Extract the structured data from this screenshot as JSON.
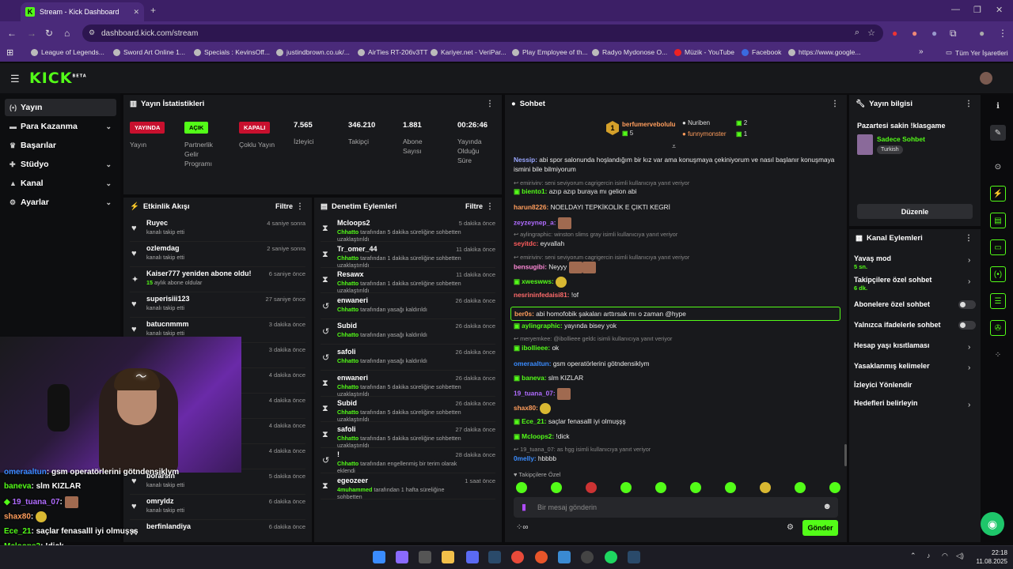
{
  "browser": {
    "tab_title": "Stream - Kick Dashboard",
    "url": "dashboard.kick.com/stream",
    "bookmarks": [
      "League of Legends...",
      "Sword Art Online 1...",
      "Specials : KevinsOff...",
      "justindbrown.co.uk/...",
      "AirTies RT-206v3TT",
      "Kariyer.net - VeriPar...",
      "Play Employee of th...",
      "Radyo Mydonose O...",
      "Müzik - YouTube",
      "Facebook",
      "https://www.google..."
    ],
    "all_bookmarks": "Tüm Yer İşaretleri"
  },
  "app": {
    "logo": "KICK",
    "logo_sup": "BETA"
  },
  "sidebar": {
    "items": [
      {
        "label": "Yayın",
        "icon": "broadcast-icon"
      },
      {
        "label": "Para Kazanma",
        "icon": "money-icon"
      },
      {
        "label": "Başarılar",
        "icon": "trophy-icon"
      },
      {
        "label": "Stüdyo",
        "icon": "studio-icon"
      },
      {
        "label": "Kanal",
        "icon": "channel-icon"
      },
      {
        "label": "Ayarlar",
        "icon": "gear-icon"
      }
    ]
  },
  "stats": {
    "title": "Yayın İstatistikleri",
    "badges": [
      {
        "badge": "YAYINDA",
        "label": "Yayın",
        "color": "#c8102e"
      },
      {
        "badge": "AÇIK",
        "label": "Partnerlik Gelir Programı",
        "color": "#53fc18"
      },
      {
        "badge": "KAPALI",
        "label": "Çoklu Yayın",
        "color": "#c8102e"
      }
    ],
    "values": [
      {
        "value": "7.565",
        "label": "İzleyici"
      },
      {
        "value": "346.210",
        "label": "Takipçi"
      },
      {
        "value": "1.881",
        "label": "Abone Sayısı"
      },
      {
        "value": "00:26:46",
        "label": "Yayında Olduğu Süre"
      }
    ]
  },
  "activity": {
    "title": "Etkinlik Akışı",
    "filter": "Filtre",
    "items": [
      {
        "name": "Ruyec",
        "desc": "kanalı takip etti",
        "time": "4 saniye sonra"
      },
      {
        "name": "ozlemdag",
        "desc": "kanalı takip etti",
        "time": "2 saniye sonra"
      },
      {
        "name": "Kaiser777 yeniden abone oldu!",
        "desc_num": "15",
        "desc": "aylık abone oldular",
        "time": "6 saniye önce"
      },
      {
        "name": "superisiii123",
        "desc": "kanalı takip etti",
        "time": "27 saniye önce"
      },
      {
        "name": "batucnmmm",
        "desc": "kanalı takip etti",
        "time": "3 dakika önce"
      },
      {
        "name": "",
        "desc": "",
        "time": "3 dakika önce"
      },
      {
        "name": "",
        "desc": "",
        "time": "4 dakika önce"
      },
      {
        "name": "",
        "desc": "",
        "time": "4 dakika önce"
      },
      {
        "name": "",
        "desc": "",
        "time": "4 dakika önce"
      },
      {
        "name": "",
        "desc": "",
        "time": "4 dakika önce"
      },
      {
        "name": "borarsln",
        "desc": "kanalı takip etti",
        "time": "5 dakika önce"
      },
      {
        "name": "omryldz",
        "desc": "kanalı takip etti",
        "time": "6 dakika önce"
      },
      {
        "name": "berfinlandiya",
        "desc": "",
        "time": "6 dakika önce"
      }
    ]
  },
  "moderation": {
    "title": "Denetim Eylemleri",
    "filter": "Filtre",
    "items": [
      {
        "name": "Mcloops2",
        "by": "Chhatto",
        "desc": "tarafından 5 dakika süreliğine sohbetten uzaklaştırıldı",
        "time": "5 dakika önce",
        "icon": "timer-icon"
      },
      {
        "name": "Tr_omer_44",
        "by": "Chhatto",
        "desc": "tarafından 1 dakika süreliğine sohbetten uzaklaştırıldı",
        "time": "11 dakika önce",
        "icon": "timer-icon"
      },
      {
        "name": "Resawx",
        "by": "Chhatto",
        "desc": "tarafından 1 dakika süreliğine sohbetten uzaklaştırıldı",
        "time": "11 dakika önce",
        "icon": "timer-icon"
      },
      {
        "name": "enwaneri",
        "by": "Chhatto",
        "desc": "tarafından yasağı kaldırıldı",
        "time": "26 dakika önce",
        "icon": "undo-icon"
      },
      {
        "name": "Subid",
        "by": "Chhatto",
        "desc": "tarafından yasağı kaldırıldı",
        "time": "26 dakika önce",
        "icon": "undo-icon"
      },
      {
        "name": "safoli",
        "by": "Chhatto",
        "desc": "tarafından yasağı kaldırıldı",
        "time": "26 dakika önce",
        "icon": "undo-icon"
      },
      {
        "name": "enwaneri",
        "by": "Chhatto",
        "desc": "tarafından 5 dakika süreliğine sohbetten uzaklaştırıldı",
        "time": "26 dakika önce",
        "icon": "timer-icon"
      },
      {
        "name": "Subid",
        "by": "Chhatto",
        "desc": "tarafından 5 dakika süreliğine sohbetten uzaklaştırıldı",
        "time": "26 dakika önce",
        "icon": "timer-icon"
      },
      {
        "name": "safoli",
        "by": "Chhatto",
        "desc": "tarafından 5 dakika süreliğine sohbetten uzaklaştırıldı",
        "time": "27 dakika önce",
        "icon": "timer-icon"
      },
      {
        "name": "!",
        "by": "Chhatto",
        "desc": "tarafından engellenmiş bir terim olarak eklendi",
        "time": "28 dakika önce",
        "icon": "undo-icon"
      },
      {
        "name": "egeozeer",
        "by": "4muhammed",
        "desc": "tarafından 1 hafta süreliğine sohbetten",
        "time": "1 saat önce",
        "icon": "timer-icon"
      }
    ]
  },
  "chat": {
    "title": "Sohbet",
    "top_gifters": [
      {
        "name": "berfumerveboluIu",
        "count": "5"
      },
      {
        "name": "Nuriben",
        "count": "2"
      },
      {
        "name": "funnymonster",
        "count": "1"
      }
    ],
    "messages": [
      {
        "user": "Nessip",
        "color": "#9aa7ff",
        "text": "abi spor salonunda hoşlandığım bir kız var ama konuşmaya çekiniyorum ve nasıl başlanır konuşmaya"
      },
      {
        "user": "",
        "color": "#ececec",
        "text": "ismini bile bilmiyorum"
      },
      {
        "reply": "emirivirv: seni seviyorum cagrigercin isimli kullanıcıya yanıt veriyor"
      },
      {
        "user": "biento1",
        "color": "#53fc18",
        "text": "azıp azıp buraya mı gelion abi"
      },
      {
        "user": "harun8226",
        "color": "#ff9d5c",
        "text": "NOELDAYI TEPKİKOLİK E ÇIKTI KEGRİ"
      },
      {
        "user": "zeyzeynep_a",
        "color": "#b06cff",
        "text": ""
      },
      {
        "reply": "aylingraphic: winston slims gray isimli kullanıcıya yanıt veriyor"
      },
      {
        "user": "seyitdc",
        "color": "#ff5c5c",
        "text": "eyvallah"
      },
      {
        "reply": "emirivirv: seni seviyorum cagrigercin isimli kullanıcıya yanıt veriyor"
      },
      {
        "user": "bensugibi",
        "color": "#ff8ad8",
        "text": "Neyyy"
      },
      {
        "user": "xweswws",
        "color": "#53fc18",
        "text": ""
      },
      {
        "user": "nesrininfedaisi81",
        "color": "#ff6a6a",
        "text": "!of"
      },
      {
        "user": "ber0s",
        "color": "#ff9d5c",
        "text": "abi homofobik şakaları arttırsak mı o zaman @hype"
      },
      {
        "user": "aylingraphic",
        "color": "#53fc18",
        "text": "yayında bisey yok"
      },
      {
        "reply": "meryemkee: @ibollieee geldc isimli kullanıcıya yanıt veriyor"
      },
      {
        "user": "ibollieee",
        "color": "#53fc18",
        "text": "ok"
      },
      {
        "user": "omeraaltun",
        "color": "#3a8cff",
        "text": "gsm operatörlerini götndensiklym"
      },
      {
        "user": "baneva",
        "color": "#53fc18",
        "text": "slm KIZLAR"
      },
      {
        "user": "19_tuana_07",
        "color": "#b06cff",
        "text": ""
      },
      {
        "user": "shax80",
        "color": "#ff9d5c",
        "text": ""
      },
      {
        "user": "Ece_21",
        "color": "#53fc18",
        "text": "saçlar fenasalll iyi olmuşşş"
      },
      {
        "user": "Mcloops2",
        "color": "#53fc18",
        "text": "!dick"
      },
      {
        "reply": "19_tuana_07: as hgg isimli kullanıcıya yanıt veriyor"
      },
      {
        "user": "0melly",
        "color": "#3a8cff",
        "text": "hbbbb"
      }
    ],
    "followers_only": "Takipçilere Özel",
    "input_placeholder": "Bir mesaj gönderin",
    "send_label": "Gönder"
  },
  "stream_info": {
    "title": "Yayın bilgisi",
    "stream_title": "Pazartesi sakin !klasgame",
    "category": "Sadece Sohbet",
    "tag": "Turkish",
    "edit_label": "Düzenle"
  },
  "channel_actions": {
    "title": "Kanal Eylemleri",
    "items": [
      {
        "label": "Yavaş mod",
        "sub": "5 sn.",
        "kind": "chevron"
      },
      {
        "label": "Takipçilere özel sohbet",
        "sub": "6 dk.",
        "kind": "chevron"
      },
      {
        "label": "Abonelere özel sohbet",
        "sub": "",
        "kind": "toggle"
      },
      {
        "label": "Yalnızca ifadelerle sohbet",
        "sub": "",
        "kind": "toggle"
      },
      {
        "label": "Hesap yaşı kısıtlaması",
        "sub": "",
        "kind": "chevron"
      },
      {
        "label": "Yasaklanmış kelimeler",
        "sub": "",
        "kind": "chevron"
      },
      {
        "label": "İzleyici Yönlendir",
        "sub": "",
        "kind": "none"
      },
      {
        "label": "Hedefleri belirleyin",
        "sub": "",
        "kind": "chevron"
      }
    ]
  },
  "overlay_chat": [
    {
      "user": "omeraaltun",
      "color": "#3a8cff",
      "text": ": gsm operatörlerini götndensiklym"
    },
    {
      "user": "baneva",
      "color": "#53fc18",
      "text": ": slm KIZLAR"
    },
    {
      "user": "19_tuana_07",
      "color": "#b06cff",
      "text": ":"
    },
    {
      "user": "shax80",
      "color": "#ff9d5c",
      "text": ":"
    },
    {
      "user": "Ece_21",
      "color": "#53fc18",
      "text": ": saçlar fenasalll iyi olmuşşş"
    },
    {
      "user": "Mcloops2",
      "color": "#53fc18",
      "text": ": !dick"
    },
    {
      "user": "0melly",
      "color": "#3a8cff",
      "text": ": hbbbb"
    }
  ],
  "taskbar": {
    "time": "22:18",
    "date": "11.08.2025"
  }
}
